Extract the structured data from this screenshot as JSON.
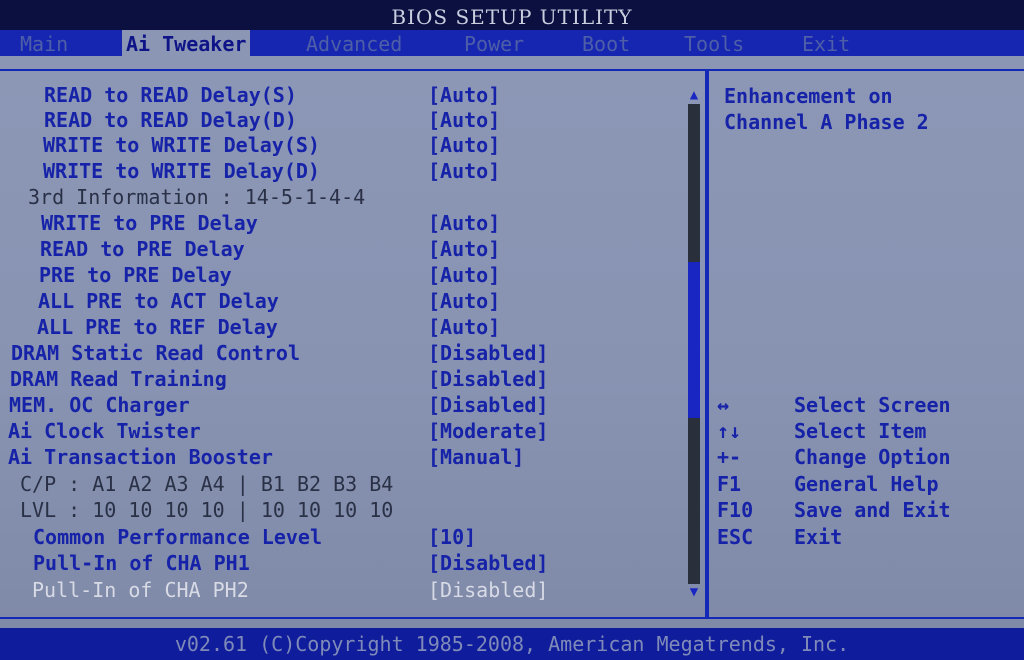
{
  "window": {
    "title": "BIOS SETUP UTILITY"
  },
  "tabs": [
    {
      "label": "Main"
    },
    {
      "label": "Ai Tweaker"
    },
    {
      "label": "Advanced"
    },
    {
      "label": "Power"
    },
    {
      "label": "Boot"
    },
    {
      "label": "Tools"
    },
    {
      "label": "Exit"
    }
  ],
  "settings": [
    {
      "label": "READ to READ Delay(S)",
      "value": "[Auto]"
    },
    {
      "label": "READ to READ Delay(D)",
      "value": "[Auto]"
    },
    {
      "label": "WRITE to WRITE Delay(S)",
      "value": "[Auto]"
    },
    {
      "label": "WRITE to WRITE Delay(D)",
      "value": "[Auto]"
    },
    {
      "label": "3rd Information : 14-5-1-4-4",
      "value": ""
    },
    {
      "label": "WRITE to PRE Delay",
      "value": "[Auto]"
    },
    {
      "label": "READ to PRE Delay",
      "value": "[Auto]"
    },
    {
      "label": "PRE to PRE Delay",
      "value": "[Auto]"
    },
    {
      "label": "ALL PRE to ACT Delay",
      "value": "[Auto]"
    },
    {
      "label": "ALL PRE to REF Delay",
      "value": "[Auto]"
    },
    {
      "label": "DRAM Static Read Control",
      "value": "[Disabled]"
    },
    {
      "label": "DRAM Read Training",
      "value": "[Disabled]"
    },
    {
      "label": "MEM. OC Charger",
      "value": "[Disabled]"
    },
    {
      "label": "Ai Clock Twister",
      "value": "[Moderate]"
    },
    {
      "label": "Ai Transaction Booster",
      "value": "[Manual]"
    },
    {
      "label": "C/P : A1 A2 A3 A4 | B1 B2 B3 B4",
      "value": ""
    },
    {
      "label": "LVL : 10 10 10 10 | 10 10 10 10",
      "value": ""
    },
    {
      "label": "Common Performance Level",
      "value": "[10]"
    },
    {
      "label": "Pull-In of CHA PH1",
      "value": "[Disabled]"
    },
    {
      "label": "Pull-In of CHA PH2",
      "value": "[Disabled]"
    }
  ],
  "help": {
    "line1": "Enhancement on",
    "line2": "Channel A Phase 2"
  },
  "keys": [
    {
      "key": "↔",
      "desc": "Select Screen"
    },
    {
      "key": "↑↓",
      "desc": "Select Item"
    },
    {
      "key": "+-",
      "desc": "Change Option"
    },
    {
      "key": "F1",
      "desc": "General Help"
    },
    {
      "key": "F10",
      "desc": "Save and Exit"
    },
    {
      "key": "ESC",
      "desc": "Exit"
    }
  ],
  "scroll": {
    "up_icon": "▲",
    "down_icon": "▼"
  },
  "footer": {
    "text": "v02.61 (C)Copyright 1985-2008, American Megatrends, Inc."
  }
}
